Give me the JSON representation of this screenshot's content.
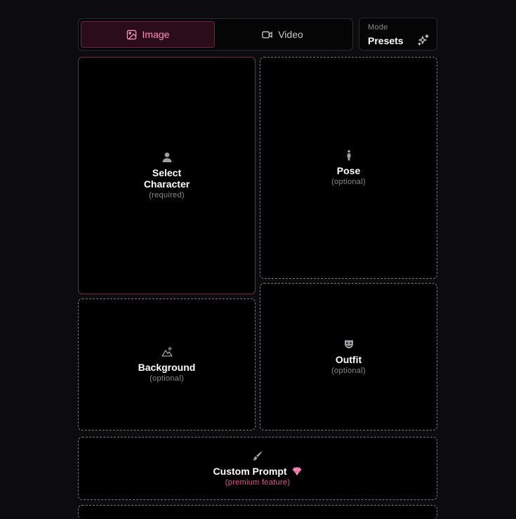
{
  "tabs": {
    "image_label": "Image",
    "video_label": "Video"
  },
  "mode": {
    "label": "Mode",
    "value": "Presets"
  },
  "cards": {
    "character": {
      "title_line1": "Select",
      "title_line2": "Character",
      "sub": "(required)"
    },
    "pose": {
      "title": "Pose",
      "sub": "(optional)"
    },
    "background": {
      "title": "Background",
      "sub": "(optional)"
    },
    "outfit": {
      "title": "Outfit",
      "sub": "(optional)"
    },
    "custom": {
      "title": "Custom Prompt",
      "sub": "(premium feature)"
    }
  },
  "colors": {
    "accent": "#ff8fc0",
    "premium": "#e0558e",
    "selected_border": "#7a2a45"
  },
  "icons": {
    "image_tab": "image-icon",
    "video_tab": "video-camera-icon",
    "mode": "sparkles-icon",
    "character": "user-icon",
    "pose": "person-standing-icon",
    "background": "mountain-icon",
    "outfit": "mask-icon",
    "custom": "paintbrush-icon",
    "premium": "gem-icon"
  }
}
